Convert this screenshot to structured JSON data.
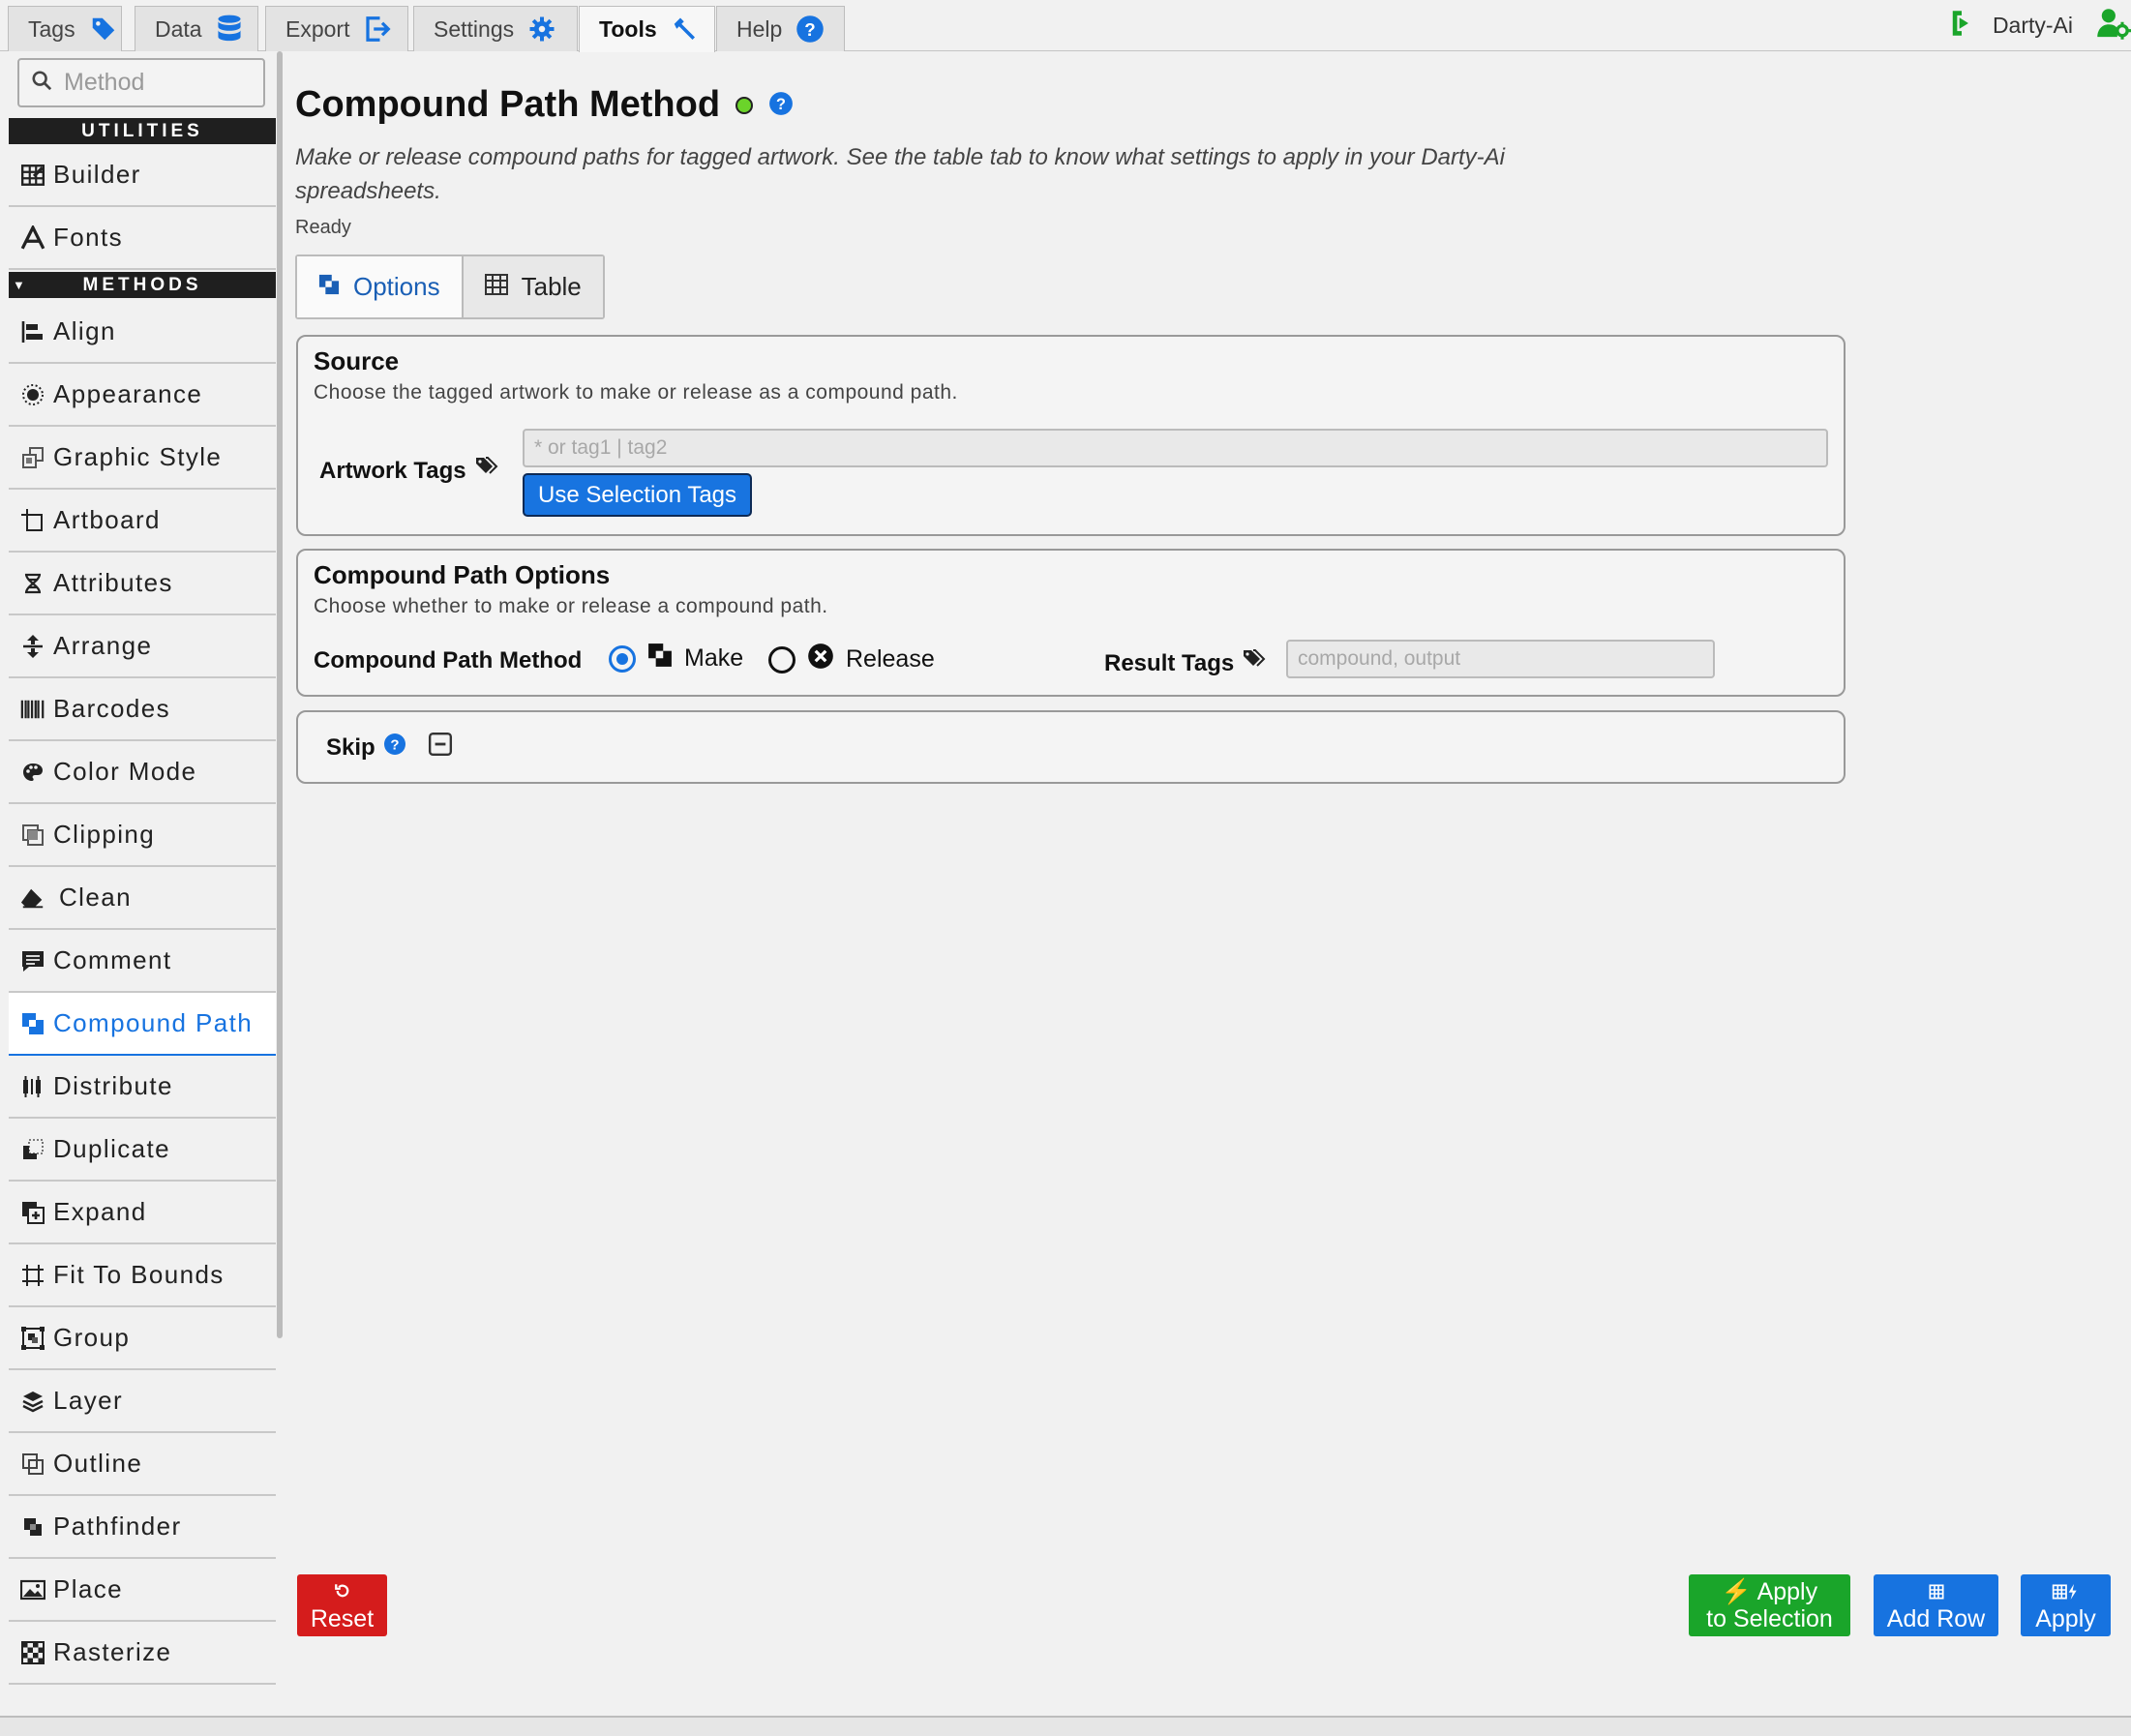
{
  "tabs": [
    {
      "label": "Tags",
      "icon": "tag-icon"
    },
    {
      "label": "Data",
      "icon": "database-icon"
    },
    {
      "label": "Export",
      "icon": "export-icon"
    },
    {
      "label": "Settings",
      "icon": "gear-icon"
    },
    {
      "label": "Tools",
      "icon": "hammer-icon",
      "active": true
    },
    {
      "label": "Help",
      "icon": "help-icon"
    }
  ],
  "user": {
    "name": "Darty-Ai"
  },
  "sidebar": {
    "search_placeholder": "Method",
    "utilities_label": "UTILITIES",
    "utilities": [
      {
        "label": "Builder",
        "icon": "table-builder-icon"
      },
      {
        "label": "Fonts",
        "icon": "font-icon"
      }
    ],
    "methods_label": "METHODS",
    "methods": [
      {
        "label": "Align",
        "icon": "align-icon"
      },
      {
        "label": "Appearance",
        "icon": "appearance-icon"
      },
      {
        "label": "Graphic Style",
        "icon": "graphic-style-icon"
      },
      {
        "label": "Artboard",
        "icon": "artboard-icon"
      },
      {
        "label": "Attributes",
        "icon": "attributes-icon"
      },
      {
        "label": "Arrange",
        "icon": "arrange-icon"
      },
      {
        "label": "Barcodes",
        "icon": "barcode-icon"
      },
      {
        "label": "Color Mode",
        "icon": "palette-icon"
      },
      {
        "label": "Clipping",
        "icon": "clipping-icon"
      },
      {
        "label": "Clean",
        "icon": "eraser-icon"
      },
      {
        "label": "Comment",
        "icon": "comment-icon"
      },
      {
        "label": "Compound Path",
        "icon": "compound-path-icon",
        "active": true
      },
      {
        "label": "Distribute",
        "icon": "distribute-icon"
      },
      {
        "label": "Duplicate",
        "icon": "duplicate-icon"
      },
      {
        "label": "Expand",
        "icon": "expand-icon"
      },
      {
        "label": "Fit To Bounds",
        "icon": "fit-bounds-icon"
      },
      {
        "label": "Group",
        "icon": "group-icon"
      },
      {
        "label": "Layer",
        "icon": "layer-icon"
      },
      {
        "label": "Outline",
        "icon": "outline-icon"
      },
      {
        "label": "Pathfinder",
        "icon": "pathfinder-icon"
      },
      {
        "label": "Place",
        "icon": "image-icon"
      },
      {
        "label": "Rasterize",
        "icon": "rasterize-icon"
      }
    ]
  },
  "main": {
    "title": "Compound Path Method",
    "status_color": "#6bd42a",
    "description": "Make or release compound paths for tagged artwork. See the table tab to know what settings to apply in your Darty-Ai spreadsheets.",
    "status": "Ready",
    "subtabs": [
      {
        "label": "Options",
        "icon": "compound-path-icon"
      },
      {
        "label": "Table",
        "icon": "table-icon"
      }
    ],
    "source": {
      "title": "Source",
      "subtitle": "Choose the tagged artwork to make or release as a compound path.",
      "artwork_tags_label": "Artwork Tags",
      "artwork_tags_placeholder": "* or tag1 | tag2",
      "artwork_tags_value": "",
      "use_selection_label": "Use Selection Tags"
    },
    "options": {
      "title": "Compound Path Options",
      "subtitle": "Choose whether to make or release a compound path.",
      "method_label": "Compound Path Method",
      "make_label": "Make",
      "release_label": "Release",
      "selected": "Make",
      "result_tags_label": "Result Tags",
      "result_tags_placeholder": "compound, output",
      "result_tags_value": ""
    },
    "skip": {
      "label": "Skip"
    }
  },
  "footer": {
    "reset": "Reset",
    "apply_selection_line1": "Apply",
    "apply_selection_line2": "to Selection",
    "add_row": "Add Row",
    "apply": "Apply"
  },
  "colors": {
    "accent": "#1773e0",
    "reset": "#d51c1c",
    "apply_selection": "#1aa52a",
    "add_row": "#1773e0"
  }
}
